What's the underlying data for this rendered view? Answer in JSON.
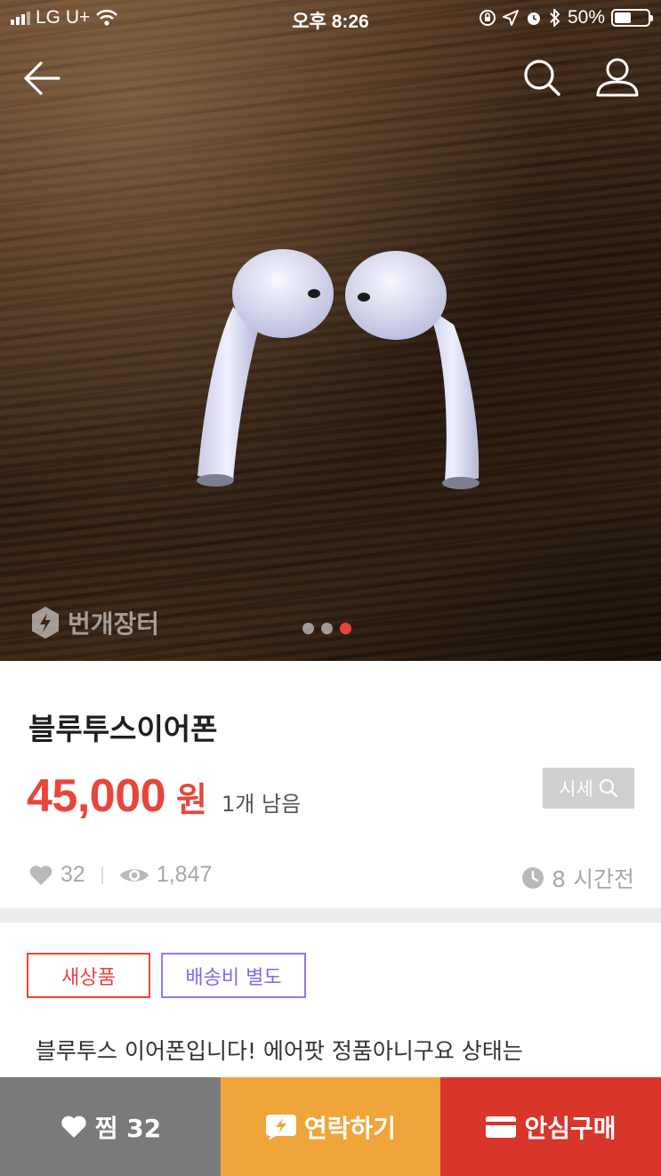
{
  "status_bar": {
    "carrier": "LG U+",
    "time": "오후 8:26",
    "battery": "50%"
  },
  "hero": {
    "watermark": "번개장터",
    "page_count": 3,
    "active_page": 3
  },
  "product": {
    "title": "블루투스이어폰",
    "price": "45,000",
    "currency": "원",
    "stock": "1개 남음",
    "market_price_button": "시세",
    "likes": "32",
    "views": "1,847",
    "posted": "8 시간전"
  },
  "tags": {
    "condition": "새상품",
    "shipping": "배송비 별도"
  },
  "description": "블루투스 이어폰입니다! 에어팟 정품아니구요 상태는",
  "bottom_bar": {
    "like_label": "찜 32",
    "contact_label": "연락하기",
    "safe_buy_label": "안심구매"
  },
  "colors": {
    "accent_red": "#e8453c",
    "contact_orange": "#efa53a",
    "buy_red": "#d9362b",
    "tag_purple": "#7c6cf0"
  },
  "icons": [
    "back-arrow-icon",
    "search-icon",
    "profile-icon",
    "heart-icon",
    "eye-icon",
    "clock-icon",
    "chat-bolt-icon",
    "card-icon",
    "wifi-icon",
    "bluetooth-icon",
    "alarm-icon",
    "location-icon",
    "rotation-lock-icon"
  ]
}
